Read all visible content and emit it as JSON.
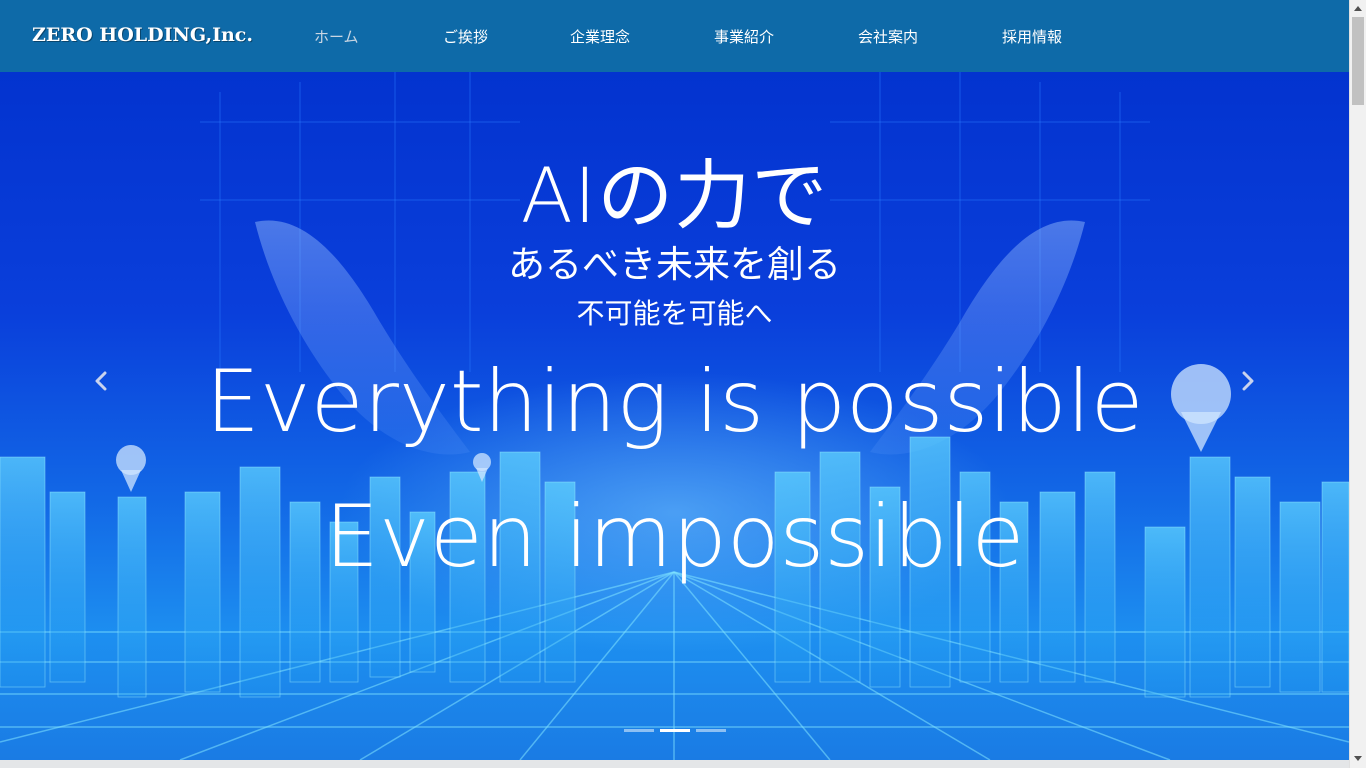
{
  "nav": {
    "brand": "ZERO HOLDING,Inc.",
    "items": [
      {
        "label": "ホーム",
        "active": true
      },
      {
        "label": "ご挨拶",
        "active": false
      },
      {
        "label": "企業理念",
        "active": false
      },
      {
        "label": "事業紹介",
        "active": false
      },
      {
        "label": "会社案内",
        "active": false
      },
      {
        "label": "採用情報",
        "active": false
      }
    ]
  },
  "hero": {
    "headline": "AIの力で",
    "subline": "あるべき未来を創る",
    "tagline": "不可能を可能へ",
    "english_1": "Everything is possible",
    "english_2": "Even impossible",
    "prev_icon": "chevron-left-icon",
    "next_icon": "chevron-right-icon",
    "active_slide": 2,
    "slide_count": 3
  },
  "colors": {
    "navbar": "#0e6aa8",
    "hero_top": "#0333cf",
    "hero_bottom": "#1d8ff0",
    "text": "#ffffff"
  }
}
